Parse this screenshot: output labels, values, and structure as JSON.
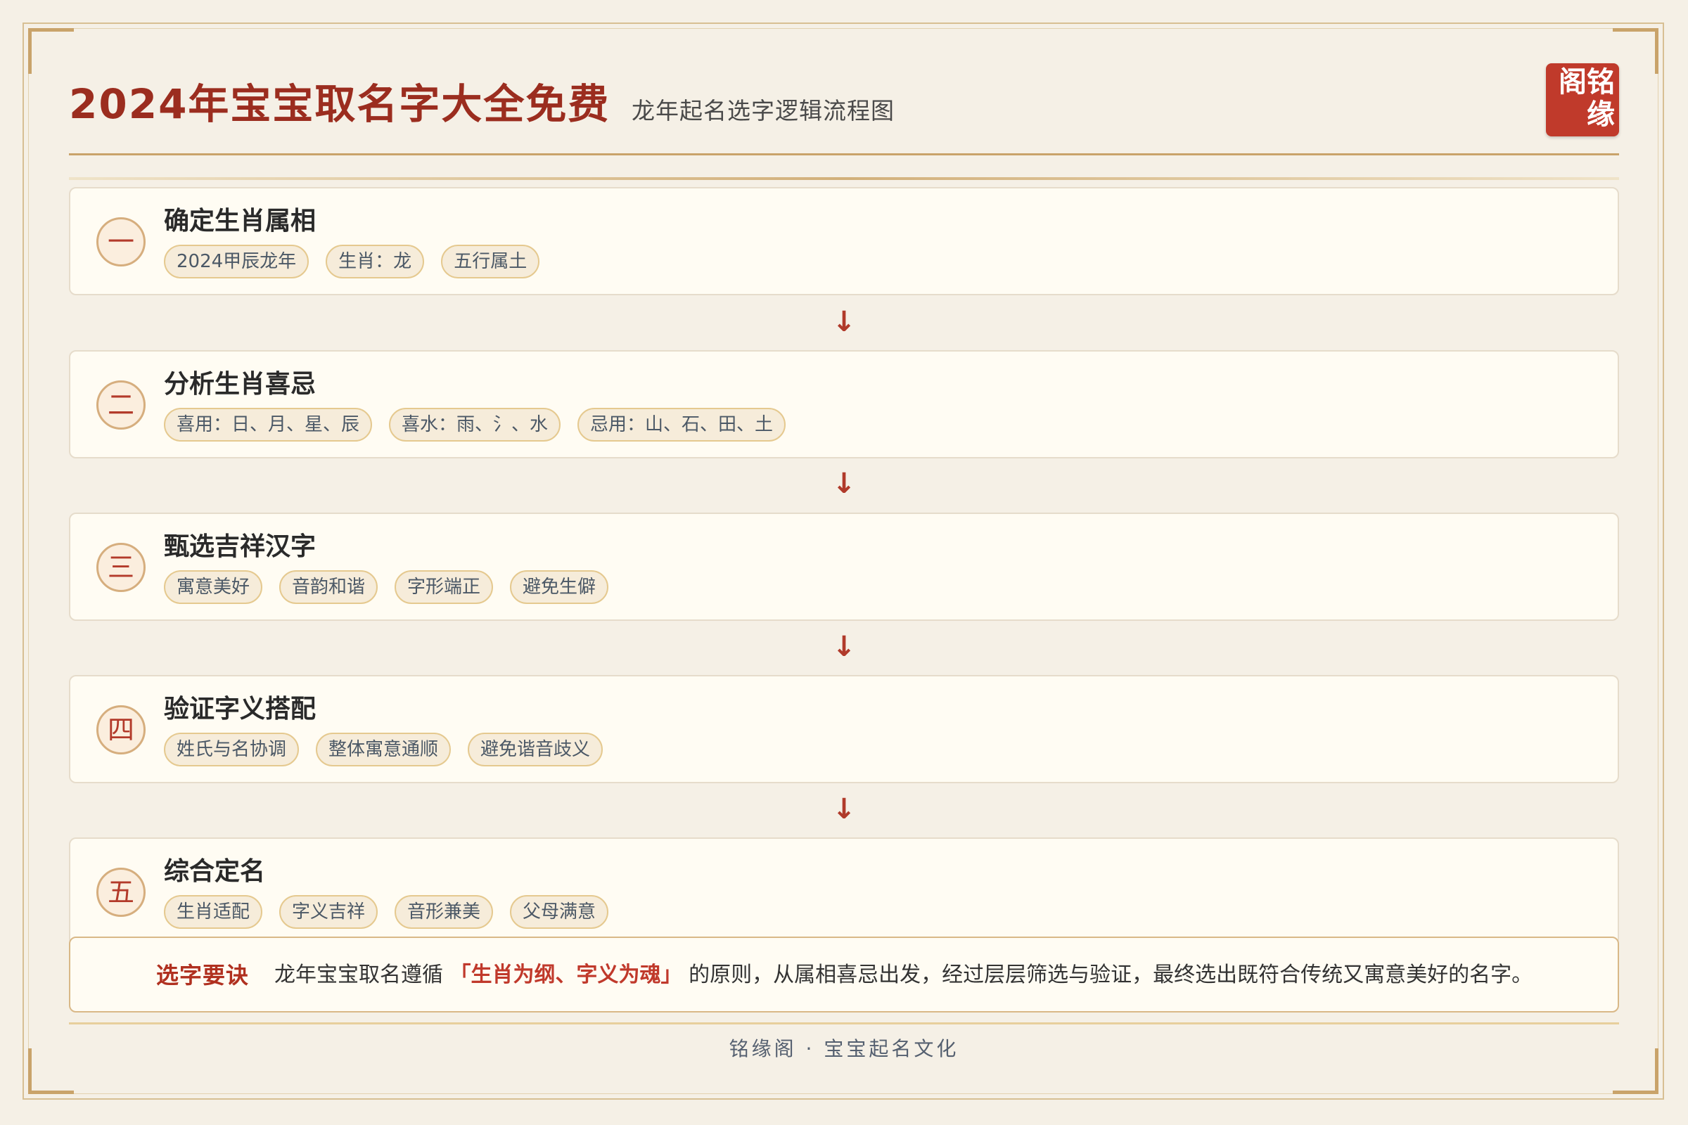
{
  "header": {
    "title": "2024年宝宝取名字大全免费",
    "subtitle": "龙年起名选字逻辑流程图",
    "seal_chars": [
      "阁铭",
      "缘"
    ]
  },
  "steps": [
    {
      "num": "一",
      "title": "确定生肖属相",
      "tags": [
        "2024甲辰龙年",
        "生肖：龙",
        "五行属土"
      ]
    },
    {
      "num": "二",
      "title": "分析生肖喜忌",
      "tags": [
        "喜用：日、月、星、辰",
        "喜水：雨、氵、水",
        "忌用：山、石、田、土"
      ]
    },
    {
      "num": "三",
      "title": "甄选吉祥汉字",
      "tags": [
        "寓意美好",
        "音韵和谐",
        "字形端正",
        "避免生僻"
      ]
    },
    {
      "num": "四",
      "title": "验证字义搭配",
      "tags": [
        "姓氏与名协调",
        "整体寓意通顺",
        "避免谐音歧义"
      ]
    },
    {
      "num": "五",
      "title": "综合定名",
      "tags": [
        "生肖适配",
        "字义吉祥",
        "音形兼美",
        "父母满意"
      ]
    }
  ],
  "arrow_glyph": "↓",
  "tip": {
    "label": "选字要诀",
    "text_before": "龙年宝宝取名遵循",
    "highlight": "「生肖为纲、字义为魂」",
    "text_after": "的原则，从属相喜忌出发，经过层层筛选与验证，最终选出既符合传统又寓意美好的名字。"
  },
  "footer": "铭缘阁 · 宝宝起名文化",
  "colors": {
    "accent": "#9b2d1f",
    "gold": "#c9a36a",
    "seal": "#c03a2b",
    "background": "#f5f0e6"
  }
}
